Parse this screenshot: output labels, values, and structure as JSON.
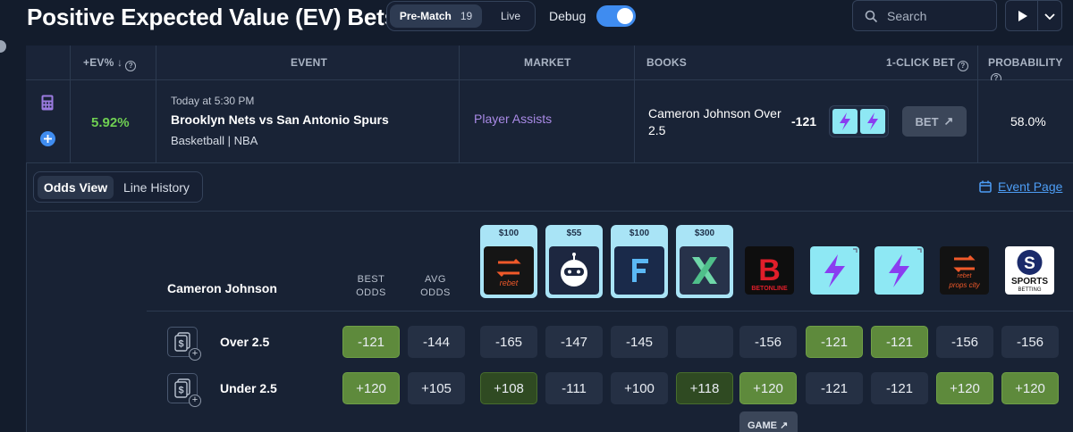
{
  "header": {
    "title": "Positive Expected Value (EV) Bets",
    "segment_active": "Pre-Match",
    "segment_active_count": "19",
    "segment_other": "Live",
    "debug_label": "Debug",
    "debug_on": true,
    "search_placeholder": "Search"
  },
  "table": {
    "headers": {
      "ev": "+EV%",
      "ev_sort": "↓",
      "event": "EVENT",
      "market": "MARKET",
      "books": "BOOKS",
      "one_click": "1-CLICK BET",
      "probability": "PROBABILITY"
    },
    "row": {
      "ev": "5.92%",
      "time": "Today at 5:30 PM",
      "event": "Brooklyn Nets vs San Antonio Spurs",
      "league": "Basketball | NBA",
      "market": "Player Assists",
      "books_line": "Cameron Johnson Over 2.5",
      "books_odds": "-121",
      "bet_label": "BET",
      "probability": "58.0%"
    }
  },
  "detail": {
    "tab_active": "Odds View",
    "tab_other": "Line History",
    "event_page_link": "Event Page",
    "player": "Cameron Johnson",
    "col_best": "BEST ODDS",
    "col_avg": "AVG ODDS",
    "promos": [
      "$100",
      "$55",
      "$100",
      "$300"
    ],
    "books": [
      {
        "name": "rebet",
        "sub": ""
      },
      {
        "name": "robot-book",
        "sub": ""
      },
      {
        "name": "fliff",
        "sub": ""
      },
      {
        "name": "x-book",
        "sub": ""
      },
      {
        "name": "B",
        "sub": "BETONLINE"
      },
      {
        "name": "lightning-book",
        "sub": ""
      },
      {
        "name": "lightning-book",
        "sub": ""
      },
      {
        "name": "rebet",
        "sub": "props city"
      },
      {
        "name": "S",
        "sub": "SPORTS BETTING"
      }
    ],
    "lines": [
      {
        "label": "Over 2.5",
        "best": "-121",
        "avg": "-144",
        "odds": [
          "-165",
          "-147",
          "-145",
          "",
          "-156",
          "-121",
          "-121",
          "-156",
          "-156"
        ],
        "styles": [
          "d",
          "d",
          "d",
          "d",
          "d",
          "g",
          "g",
          "d",
          "d"
        ]
      },
      {
        "label": "Under 2.5",
        "best": "+120",
        "avg": "+105",
        "odds": [
          "+108",
          "-111",
          "+100",
          "+118",
          "+120",
          "-121",
          "-121",
          "+120",
          "+120"
        ],
        "styles": [
          "dg",
          "d",
          "d",
          "dg",
          "g",
          "d",
          "d",
          "g",
          "g"
        ]
      }
    ],
    "game_button": "GAME"
  },
  "colors": {
    "accent": "#3f8cf0",
    "positive": "#6fcf52",
    "market": "#a98ae6",
    "link": "#4d9df5"
  }
}
